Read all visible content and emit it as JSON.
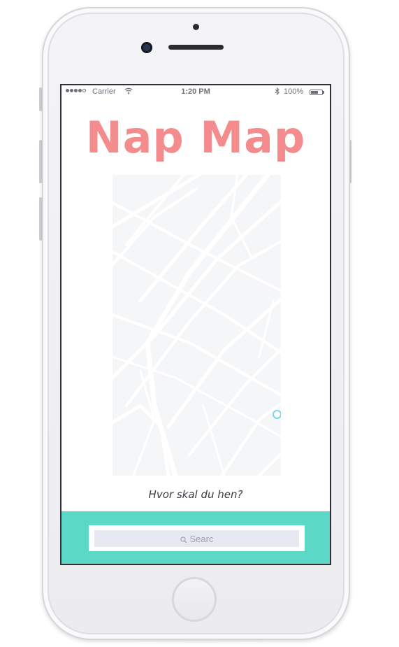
{
  "status_bar": {
    "signal_bars": 4,
    "signal_total": 5,
    "carrier": "Carrier",
    "time": "1:20 PM",
    "battery": "100%"
  },
  "app": {
    "title": "Nap Map",
    "prompt": "Hvor skal du hen?",
    "search": {
      "value": "Searc",
      "icon": "search-icon"
    }
  },
  "colors": {
    "title": "#f48c8d",
    "search_panel": "#5cd8c6",
    "search_field": "#e6e9f1",
    "map_background": "#f5f6f8",
    "location_marker": "#7fd6ec"
  }
}
